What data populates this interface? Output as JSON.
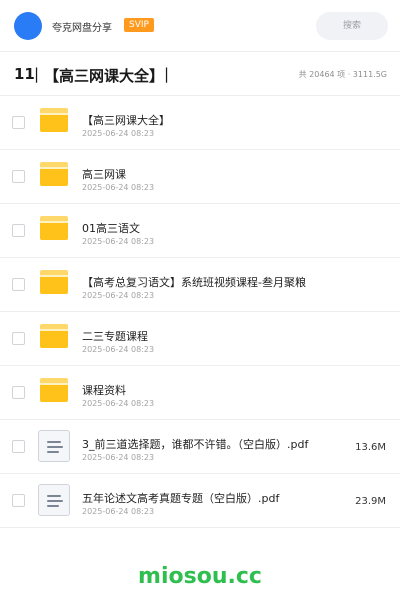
{
  "header": {
    "share_name": "夸克网盘分享",
    "badge": "SVIP",
    "search_label": "搜索",
    "accent_color": "#2a7cf6",
    "badge_color": "#ff9a1f"
  },
  "folder_bar": {
    "count": "11",
    "separator": "|",
    "title": "【高三网课大全】",
    "stats": "共 20464 项 · 3111.5G"
  },
  "files": [
    {
      "name": "【高三网课大全】",
      "date": "2025-06-24 08:23",
      "type": "folder-icon",
      "size": ""
    },
    {
      "name": "高三网课",
      "date": "2025-06-24 08:23",
      "type": "folder-icon",
      "size": ""
    },
    {
      "name": "01高三语文",
      "date": "2025-06-24 08:23",
      "type": "folder-icon",
      "size": ""
    },
    {
      "name": "【高考总复习语文】系统班视频课程-叁月聚粮",
      "date": "2025-06-24 08:23",
      "type": "folder-icon",
      "size": ""
    },
    {
      "name": "二三专题课程",
      "date": "2025-06-24 08:23",
      "type": "folder-icon",
      "size": ""
    },
    {
      "name": "课程资料",
      "date": "2025-06-24 08:23",
      "type": "folder-icon",
      "size": ""
    },
    {
      "name": "3_前三道选择题，谁都不许错。（空白版）.pdf",
      "date": "2025-06-24 08:23",
      "type": "document-icon",
      "size": "13.6M"
    },
    {
      "name": "五年论述文高考真题专题（空白版）.pdf",
      "date": "2025-06-24 08:23",
      "type": "document-icon",
      "size": "23.9M"
    }
  ],
  "watermark": "miosou.cc"
}
